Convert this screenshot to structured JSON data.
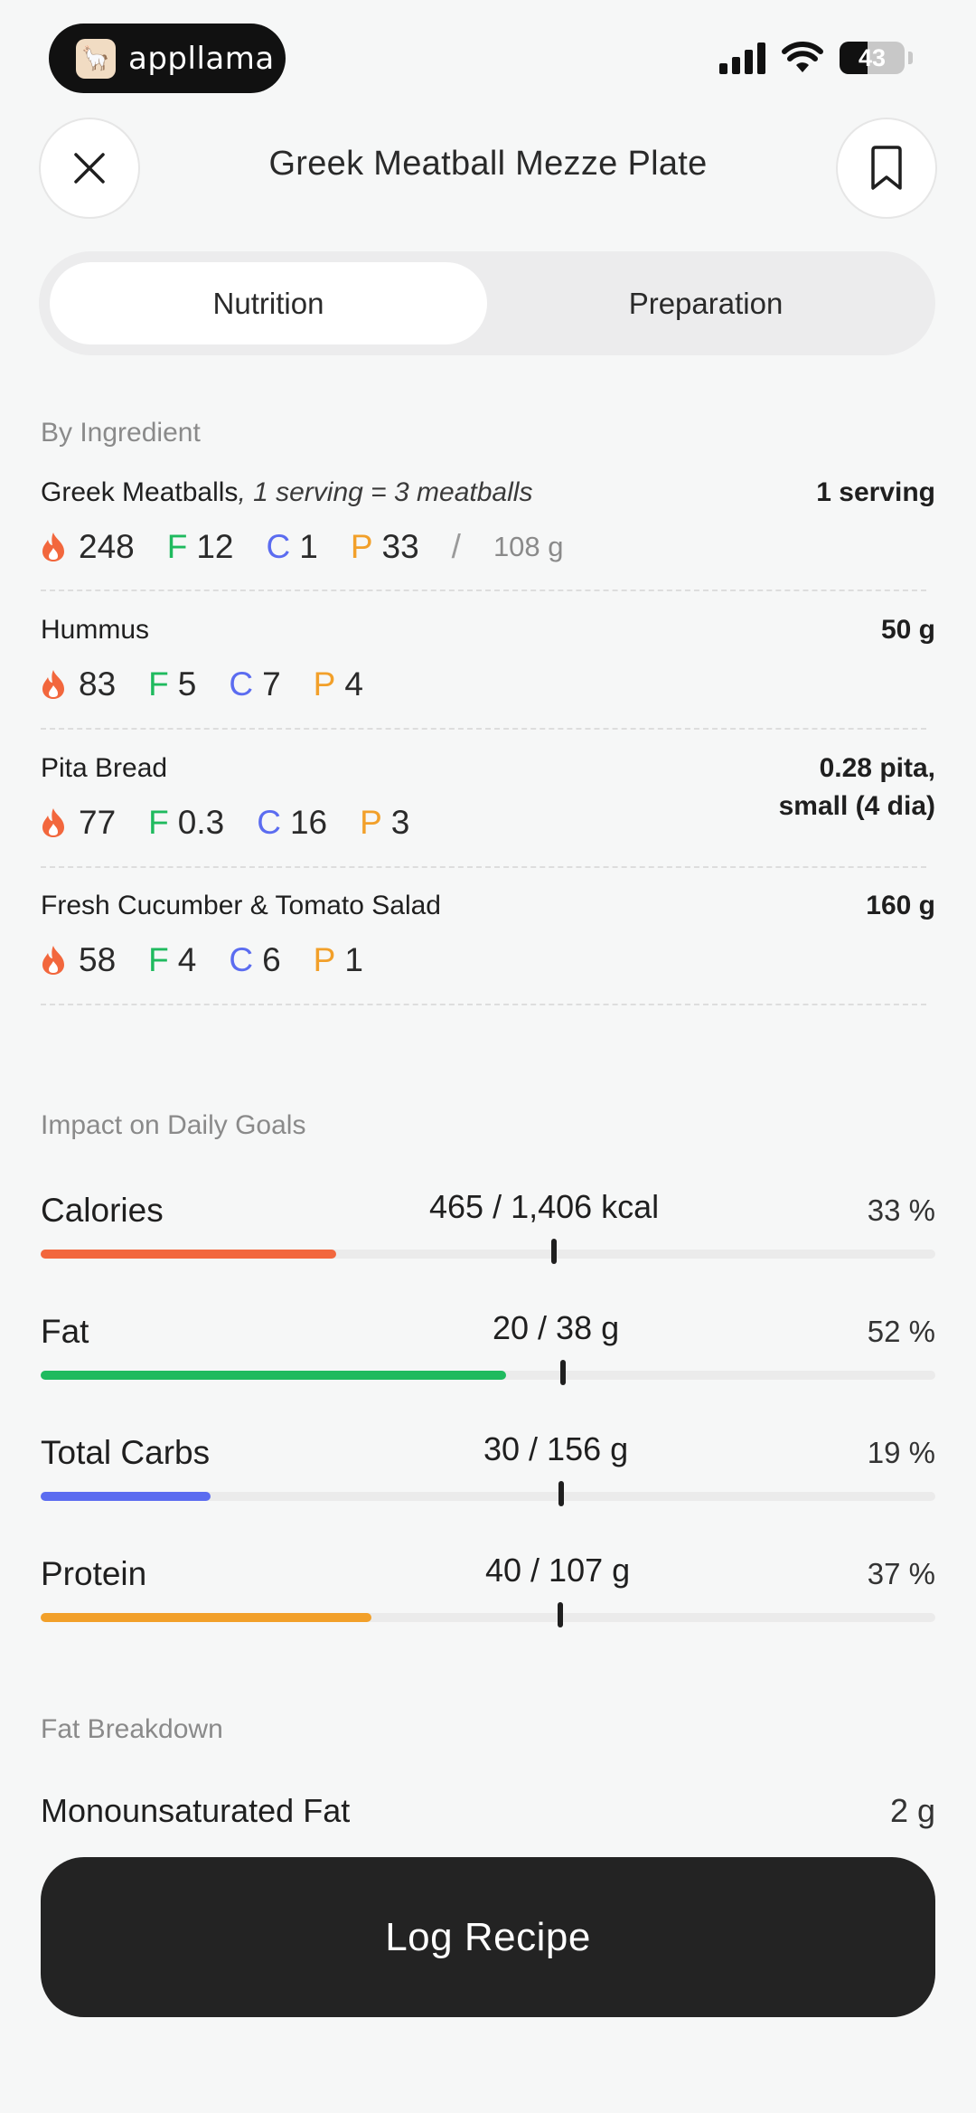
{
  "status_bar": {
    "app_badge_label": "appllama",
    "battery": "43",
    "battery_level": 0.43
  },
  "header": {
    "title": "Greek Meatball Mezze Plate"
  },
  "tabs": [
    {
      "label": "Nutrition",
      "active": true
    },
    {
      "label": "Preparation",
      "active": false
    }
  ],
  "by_ingredient": {
    "label": "By Ingredient",
    "items": [
      {
        "name": "Greek Meatballs",
        "note": ", 1 serving = 3 meatballs",
        "quantity": "1 serving",
        "cal": "248",
        "fat": "12",
        "carbs": "1",
        "protein": "33",
        "weight": "108 g"
      },
      {
        "name": "Hummus",
        "note": "",
        "quantity": "50 g",
        "cal": "83",
        "fat": "5",
        "carbs": "7",
        "protein": "4"
      },
      {
        "name": "Pita Bread",
        "note": "",
        "quantity_line1": "0.28 pita,",
        "quantity_line2": "small  (4 dia)",
        "cal": "77",
        "fat": "0.3",
        "carbs": "16",
        "protein": "3"
      },
      {
        "name": "Fresh Cucumber & Tomato Salad",
        "note": "",
        "quantity": "160 g",
        "cal": "58",
        "fat": "4",
        "carbs": "6",
        "protein": "1"
      }
    ],
    "letters": {
      "fat": "F",
      "carbs": "C",
      "protein": "P",
      "slash": "/"
    }
  },
  "daily_goals": {
    "label": "Impact on Daily Goals",
    "items": [
      {
        "name": "Calories",
        "value": "465 / 1,406 kcal",
        "pct": "33 %",
        "fraction": 0.33,
        "color": "#f2673d"
      },
      {
        "name": "Fat",
        "value": "20 / 38 g",
        "pct": "52 %",
        "fraction": 0.52,
        "color": "#1fba5e"
      },
      {
        "name": "Total Carbs",
        "value": "30 / 156 g",
        "pct": "19 %",
        "fraction": 0.19,
        "color": "#5b6cf0"
      },
      {
        "name": "Protein",
        "value": "40 / 107 g",
        "pct": "37 %",
        "fraction": 0.37,
        "color": "#f2a02a"
      }
    ]
  },
  "fat_breakdown": {
    "label": "Fat Breakdown",
    "items": [
      {
        "name": "Monounsaturated Fat",
        "value": "2 g"
      }
    ]
  },
  "cta": {
    "label": "Log Recipe"
  },
  "colors": {
    "calories": "#f2673d",
    "fat": "#1fba5e",
    "carbs": "#5b6cf0",
    "protein": "#f2a02a"
  }
}
